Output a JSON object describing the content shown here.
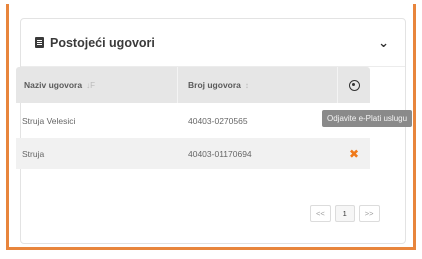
{
  "panel": {
    "title": "Postojeći ugovori",
    "toggle_icon": "chevron-down-icon"
  },
  "table": {
    "columns": [
      "Naziv ugovora",
      "Broj ugovora"
    ],
    "rows": [
      {
        "name": "Struja Velesici",
        "number": "40403-0270565"
      },
      {
        "name": "Struja",
        "number": "40403-01170694"
      }
    ],
    "action_icon": "close-icon",
    "action_color": "#f07a1a"
  },
  "tooltip": {
    "text": "Odjavite e-Plati uslugu"
  },
  "pagination": {
    "prev": "<<",
    "current": "1",
    "next": ">>"
  },
  "colors": {
    "accent_border": "#e8853c"
  }
}
